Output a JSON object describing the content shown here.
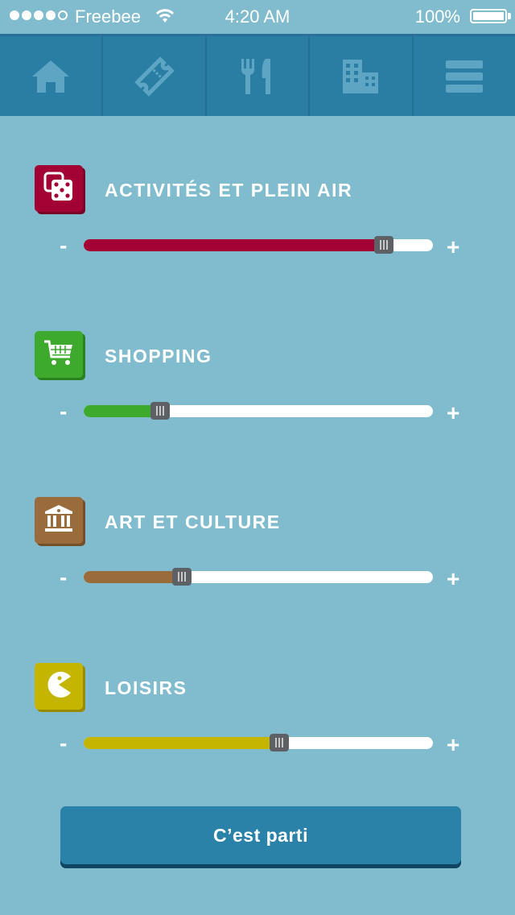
{
  "status_bar": {
    "carrier": "Freebee",
    "time": "4:20 AM",
    "battery_percent": "100%",
    "signal_bars_filled": 4,
    "signal_bars_total": 5
  },
  "nav": {
    "items": [
      {
        "name": "home-icon"
      },
      {
        "name": "ticket-icon"
      },
      {
        "name": "fork-knife-icon"
      },
      {
        "name": "buildings-icon"
      },
      {
        "name": "menu-icon"
      }
    ]
  },
  "categories": [
    {
      "label": "ACTIVITÉS ET PLEIN AIR",
      "icon": "dice-icon",
      "color": "#a30334",
      "minus": "-",
      "plus": "+",
      "value": 0.86
    },
    {
      "label": "SHOPPING",
      "icon": "cart-icon",
      "color": "#3daa2e",
      "minus": "-",
      "plus": "+",
      "value": 0.22
    },
    {
      "label": "ART ET CULTURE",
      "icon": "museum-icon",
      "color": "#9b6c3b",
      "minus": "-",
      "plus": "+",
      "value": 0.28
    },
    {
      "label": "LOISIRS",
      "icon": "pacman-icon",
      "color": "#c4b500",
      "minus": "-",
      "plus": "+",
      "value": 0.56
    }
  ],
  "go_button": {
    "label": "C’est parti"
  },
  "colors": {
    "background": "#80bccd",
    "nav_background": "#2a7ea4",
    "nav_icon": "#5da5c3",
    "slider_thumb": "#5d6166"
  }
}
